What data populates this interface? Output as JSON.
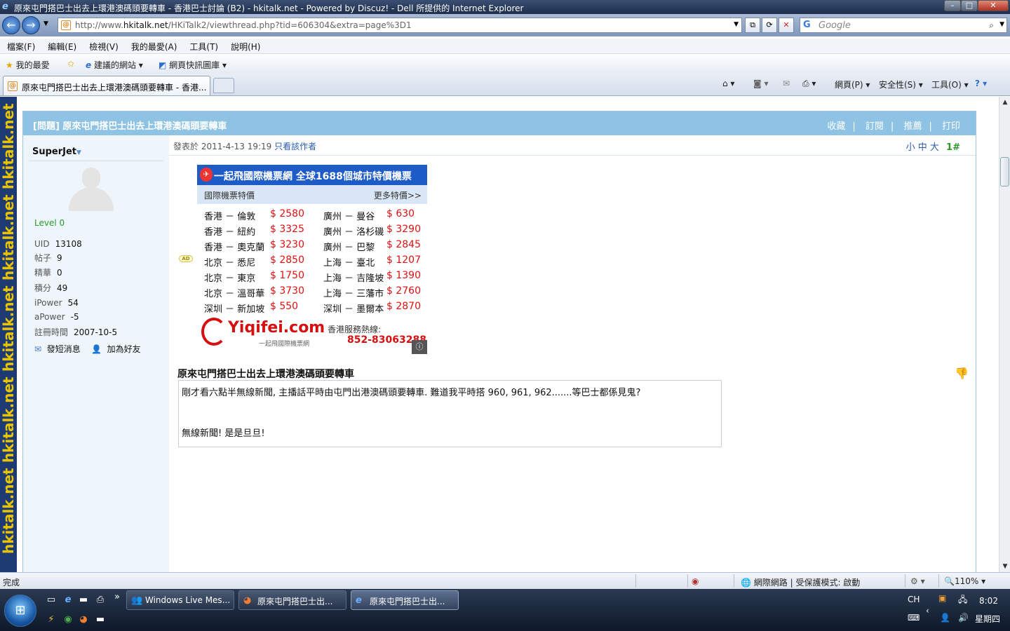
{
  "window": {
    "title": "原來屯門搭巴士出去上環港澳碼頭要轉車 - 香港巴士討論 (B2) - hkitalk.net - Powered by Discuz! - Dell 所提供的 Internet Explorer"
  },
  "address": {
    "url_prefix": "http://www.",
    "url_domain": "hkitalk.net",
    "url_path": "/HKiTalk2/viewthread.php?tid=606304&extra=page%3D1"
  },
  "search": {
    "engine_logo": "G",
    "placeholder": "Google"
  },
  "menu": [
    "檔案(F)",
    "編輯(E)",
    "檢視(V)",
    "我的最愛(A)",
    "工具(T)",
    "說明(H)"
  ],
  "favorites_bar": {
    "favorites": "我的最愛",
    "suggested": "建議的網站",
    "webslice": "網頁快訊圖庫"
  },
  "tab": {
    "label": "原來屯門搭巴士出去上環港澳碼頭要轉車 - 香港..."
  },
  "tab_tools": {
    "page": "網頁(P)",
    "safety": "安全性(S)",
    "tools": "工具(O)"
  },
  "site": {
    "brand": "hkitalk.net"
  },
  "thread": {
    "title": "[問題] 原來屯門搭巴士出去上環港澳碼頭要轉車",
    "actions": [
      "收藏",
      "訂閱",
      "推薦",
      "打印"
    ]
  },
  "author": {
    "name": "SuperJet",
    "level": "Level 0",
    "stats": [
      {
        "label": "UID",
        "value": "13108"
      },
      {
        "label": "帖子",
        "value": "9"
      },
      {
        "label": "精華",
        "value": "0"
      },
      {
        "label": "積分",
        "value": "49"
      },
      {
        "label": "iPower",
        "value": "54"
      },
      {
        "label": "aPower",
        "value": "-5"
      },
      {
        "label": "註冊時間",
        "value": "2007-10-5"
      }
    ],
    "send_pm": "發短消息",
    "add_friend": "加為好友"
  },
  "post": {
    "meta_prefix": "發表於 2011-4-13 19:19",
    "only_author": "只看該作者",
    "font_small": "小",
    "font_medium": "中",
    "font_large": "大",
    "floor": "1#",
    "title": "原來屯門搭巴士出去上環港澳碼頭要轉車",
    "body_line1": "剛才看六點半無線新聞, 主播話平時由屯門出港澳碼頭要轉車. 難道我平時搭 960, 961, 962.......等巴士都係見鬼?",
    "body_line2": "無線新聞! 是是旦旦!"
  },
  "ad": {
    "tag": "AD",
    "header": "一起飛國際機票網  全球1688個城市特價機票",
    "sub_left": "國際機票特價",
    "sub_right": "更多特價>>",
    "rows": [
      {
        "route1": "香港 － 倫敦",
        "price1": "$ 2580",
        "route2": "廣州 － 曼谷",
        "price2": "$ 630"
      },
      {
        "route1": "香港 － 紐約",
        "price1": "$ 3325",
        "route2": "廣州 － 洛杉磯",
        "price2": "$ 3290"
      },
      {
        "route1": "香港 － 奧克蘭",
        "price1": "$ 3230",
        "route2": "廣州 － 巴黎",
        "price2": "$ 2845"
      },
      {
        "route1": "北京 － 悉尼",
        "price1": "$ 2850",
        "route2": "上海 － 臺北",
        "price2": "$ 1207"
      },
      {
        "route1": "北京 － 東京",
        "price1": "$ 1750",
        "route2": "上海 － 吉隆坡",
        "price2": "$ 1390"
      },
      {
        "route1": "北京 － 溫哥華",
        "price1": "$ 3730",
        "route2": "上海 － 三藩市",
        "price2": "$ 2760"
      },
      {
        "route1": "深圳 － 新加坡",
        "price1": "$ 550",
        "route2": "深圳 － 墨爾本",
        "price2": "$ 2870"
      }
    ],
    "logo": "Yiqifei.com",
    "logo_sub": "一起飛國際機票網",
    "hotline_label": "香港服務熱線:",
    "hotline": "852-83063288"
  },
  "status": {
    "left": "完成",
    "zone": "網際網路 | 受保護模式: 啟動",
    "zoom": "110%"
  },
  "taskbar": {
    "tasks": [
      "Windows Live Mes...",
      "原來屯門搭巴士出...",
      "原來屯門搭巴士出..."
    ],
    "lang": "CH",
    "time": "8:02",
    "day": "星期四"
  }
}
